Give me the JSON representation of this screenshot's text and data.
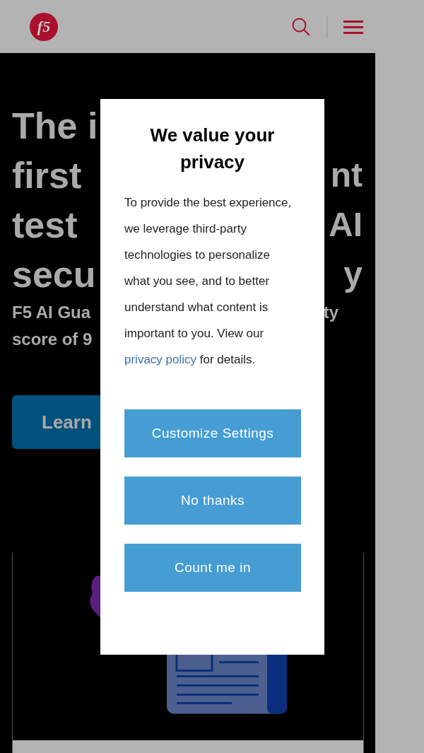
{
  "header": {
    "logo": "f5"
  },
  "hero": {
    "lines": [
      {
        "left": "The i"
      },
      {
        "left": "first",
        "right": "nt"
      },
      {
        "left": "test",
        "right": "AI"
      },
      {
        "left": "secu",
        "right": "y"
      }
    ],
    "subtitle": [
      {
        "left": "F5 AI Gua",
        "right": "ty"
      },
      {
        "left": "score of 9"
      }
    ],
    "button": "Learn"
  },
  "dialog": {
    "title": "We value your privacy",
    "body": "To provide the best experience, we leverage third-party technologies to personalize what you see, and to better understand what content is important to you. View our",
    "link": "privacy policy",
    "body_end": "for details.",
    "buttons": [
      "Customize Settings",
      "No thanks",
      "Count me in"
    ]
  }
}
